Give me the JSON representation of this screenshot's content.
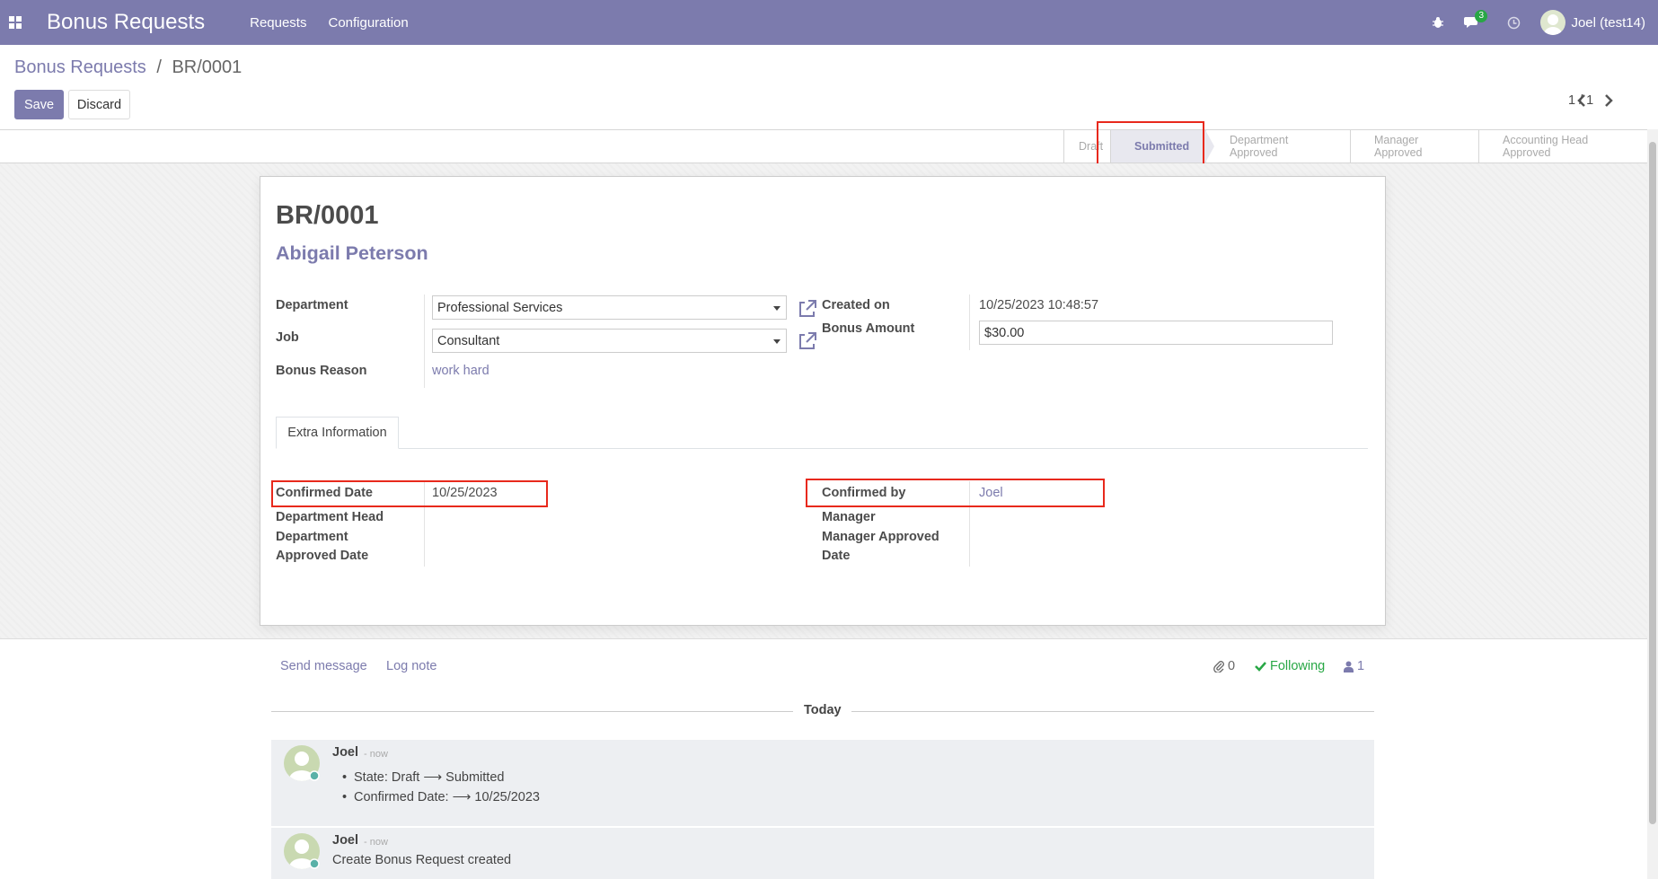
{
  "navbar": {
    "app_title": "Bonus Requests",
    "menu": [
      "Requests",
      "Configuration"
    ],
    "messages_count": "3",
    "user_name": "Joel (test14)"
  },
  "breadcrumb": {
    "parent": "Bonus Requests",
    "separator": "/",
    "current": "BR/0001"
  },
  "buttons": {
    "save": "Save",
    "discard": "Discard"
  },
  "pager": {
    "value": "1 / 1"
  },
  "statusbar": {
    "steps": [
      "Draft",
      "Submitted",
      "Department Approved",
      "Manager Approved",
      "Accounting Head Approved"
    ],
    "active": "Submitted"
  },
  "form": {
    "record_name": "BR/0001",
    "employee": "Abigail Peterson",
    "department_label": "Department",
    "department_value": "Professional Services",
    "job_label": "Job",
    "job_value": "Consultant",
    "bonus_reason_label": "Bonus Reason",
    "bonus_reason_value": "work hard",
    "created_on_label": "Created on",
    "created_on_value": "10/25/2023 10:48:57",
    "bonus_amount_label": "Bonus Amount",
    "bonus_amount_value": "$30.00"
  },
  "tabs": {
    "extra_information": "Extra Information"
  },
  "extra": {
    "confirmed_date_label": "Confirmed Date",
    "confirmed_date_value": "10/25/2023",
    "department_head_label": "Department Head",
    "department_approved_date_label_1": "Department",
    "department_approved_date_label_2": "Approved Date",
    "confirmed_by_label": "Confirmed by",
    "confirmed_by_value": "Joel",
    "manager_label": "Manager",
    "manager_approved_date_label_1": "Manager Approved",
    "manager_approved_date_label_2": "Date"
  },
  "chatter": {
    "send_message": "Send message",
    "log_note": "Log note",
    "attachments": "0",
    "following": "Following",
    "followers": "1",
    "today": "Today",
    "messages": [
      {
        "author": "Joel",
        "time": "- now",
        "changes": [
          "State: Draft ⟶ Submitted",
          "Confirmed Date: ⟶ 10/25/2023"
        ]
      },
      {
        "author": "Joel",
        "time": "- now",
        "body": "Create Bonus Request created"
      }
    ]
  },
  "colors": {
    "brand": "#7c7bad",
    "highlight": "#e8291c",
    "success": "#28a745"
  }
}
